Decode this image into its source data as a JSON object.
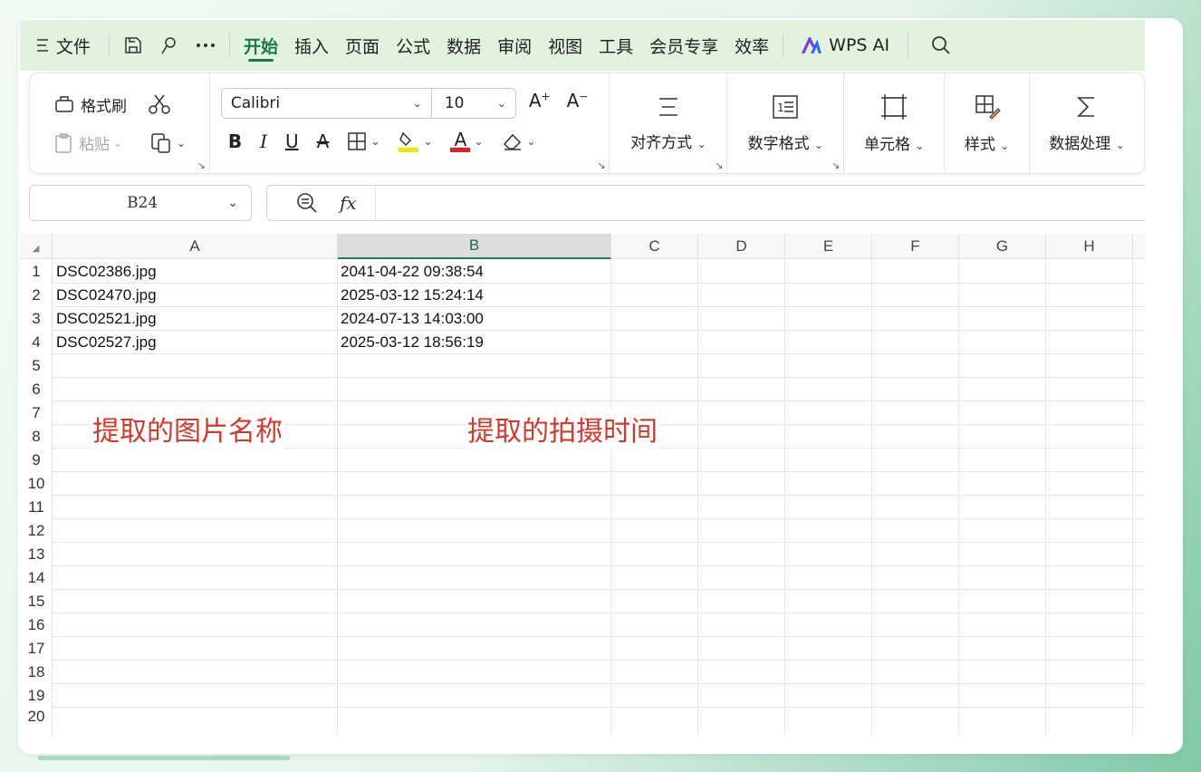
{
  "menu": {
    "file_label": "文件",
    "tabs": [
      "开始",
      "插入",
      "页面",
      "公式",
      "数据",
      "审阅",
      "视图",
      "工具",
      "会员专享",
      "效率"
    ],
    "active_tab": "开始",
    "wps_ai_label": "WPS AI"
  },
  "ribbon": {
    "format_painter": "格式刷",
    "paste": "粘贴",
    "font_name": "Calibri",
    "font_size": "10",
    "align_label": "对齐方式",
    "number_format_label": "数字格式",
    "cell_label": "单元格",
    "style_label": "样式",
    "data_process_label": "数据处理",
    "highlight_color": "#f2e600",
    "font_color": "#e02020"
  },
  "formula": {
    "name_box": "B24",
    "fx_label": "fx",
    "content": ""
  },
  "grid": {
    "corner_glyph": "◢",
    "columns": [
      "A",
      "B",
      "C",
      "D",
      "E",
      "F",
      "G",
      "H"
    ],
    "selected_column": "B",
    "row_numbers": [
      "1",
      "2",
      "3",
      "4",
      "5",
      "6",
      "7",
      "8",
      "9",
      "10",
      "11",
      "12",
      "13",
      "14",
      "15",
      "16",
      "17",
      "18",
      "19",
      "20"
    ],
    "rows": [
      {
        "a": "DSC02386.jpg",
        "b": "2041-04-22 09:38:54"
      },
      {
        "a": "DSC02470.jpg",
        "b": "2025-03-12 15:24:14"
      },
      {
        "a": "DSC02521.jpg",
        "b": "2024-07-13 14:03:00"
      },
      {
        "a": "DSC02527.jpg",
        "b": "2025-03-12 18:56:19"
      }
    ]
  },
  "annotations": {
    "left": "提取的图片名称",
    "right": "提取的拍摄时间",
    "color": "#d23a2e"
  }
}
